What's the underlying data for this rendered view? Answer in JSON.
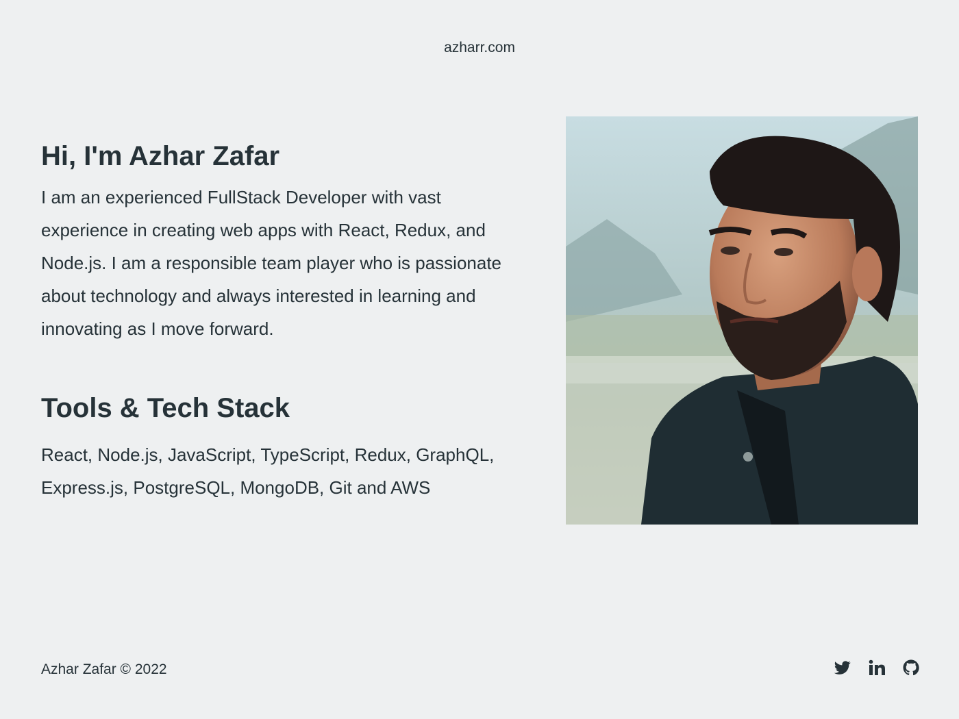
{
  "header": {
    "site_name": "azharr.com"
  },
  "intro": {
    "heading": "Hi, I'm Azhar Zafar",
    "bio": "I am an experienced FullStack Developer with vast experience in creating web apps with React, Redux, and Node.js. I am a responsible team player who is passionate about technology and always interested in learning and innovating as I move forward."
  },
  "stack": {
    "heading": "Tools & Tech Stack",
    "text": "React, Node.js, JavaScript, TypeScript, Redux, GraphQL, Express.js, PostgreSQL, MongoDB, Git and AWS"
  },
  "portrait": {
    "icon": "profile-photo"
  },
  "footer": {
    "copyright": "Azhar Zafar © 2022",
    "social": [
      {
        "icon": "twitter-icon"
      },
      {
        "icon": "linkedin-icon"
      },
      {
        "icon": "github-icon"
      }
    ]
  },
  "colors": {
    "background": "#eef0f1",
    "text": "#263238"
  }
}
